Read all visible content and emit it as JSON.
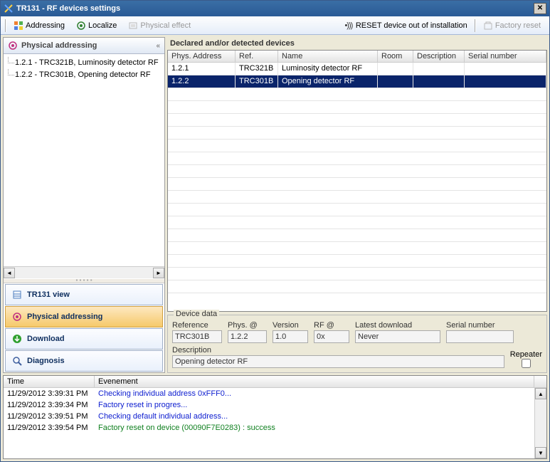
{
  "window": {
    "title": "TR131 - RF devices settings"
  },
  "toolbar": {
    "addressing": "Addressing",
    "localize": "Localize",
    "physical_effect": "Physical effect",
    "reset_device": "RESET device out of installation",
    "factory_reset": "Factory reset"
  },
  "sidebar": {
    "header": "Physical addressing",
    "tree": [
      "1.2.1 - TRC321B, Luminosity detector RF",
      "1.2.2 - TRC301B, Opening detector RF"
    ],
    "nav": {
      "tr131_view": "TR131 view",
      "physical_addressing": "Physical addressing",
      "download": "Download",
      "diagnosis": "Diagnosis"
    }
  },
  "main": {
    "section_title": "Declared and/or detected devices",
    "columns": {
      "phys_address": "Phys. Address",
      "ref": "Ref.",
      "name": "Name",
      "room": "Room",
      "description": "Description",
      "serial_number": "Serial number"
    },
    "rows": [
      {
        "addr": "1.2.1",
        "ref": "TRC321B",
        "name": "Luminosity detector RF",
        "room": "",
        "desc": "",
        "serial": "",
        "selected": false
      },
      {
        "addr": "1.2.2",
        "ref": "TRC301B",
        "name": "Opening detector RF",
        "room": "",
        "desc": "",
        "serial": "",
        "selected": true
      }
    ],
    "device_data": {
      "legend": "Device data",
      "labels": {
        "reference": "Reference",
        "phys_at": "Phys. @",
        "version": "Version",
        "rf_at": "RF @",
        "latest_download": "Latest download",
        "serial_number": "Serial number",
        "description": "Description",
        "repeater": "Repeater"
      },
      "values": {
        "reference": "TRC301B",
        "phys_at": "1.2.2",
        "version": "1.0",
        "rf_at": "0x",
        "latest_download": "Never",
        "serial_number": "",
        "description": "Opening detector RF",
        "repeater": false
      }
    }
  },
  "log": {
    "columns": {
      "time": "Time",
      "event": "Evenement"
    },
    "rows": [
      {
        "time": "11/29/2012 3:39:31 PM",
        "text": "Checking individual address 0xFFF0...",
        "color": "#1020d0"
      },
      {
        "time": "11/29/2012 3:39:34 PM",
        "text": "Factory reset in progres...",
        "color": "#1020d0"
      },
      {
        "time": "11/29/2012 3:39:51 PM",
        "text": "Checking default individual address...",
        "color": "#1020d0"
      },
      {
        "time": "11/29/2012 3:39:54 PM",
        "text": "Factory reset on device (00090F7E0283) : success",
        "color": "#108020"
      }
    ]
  }
}
